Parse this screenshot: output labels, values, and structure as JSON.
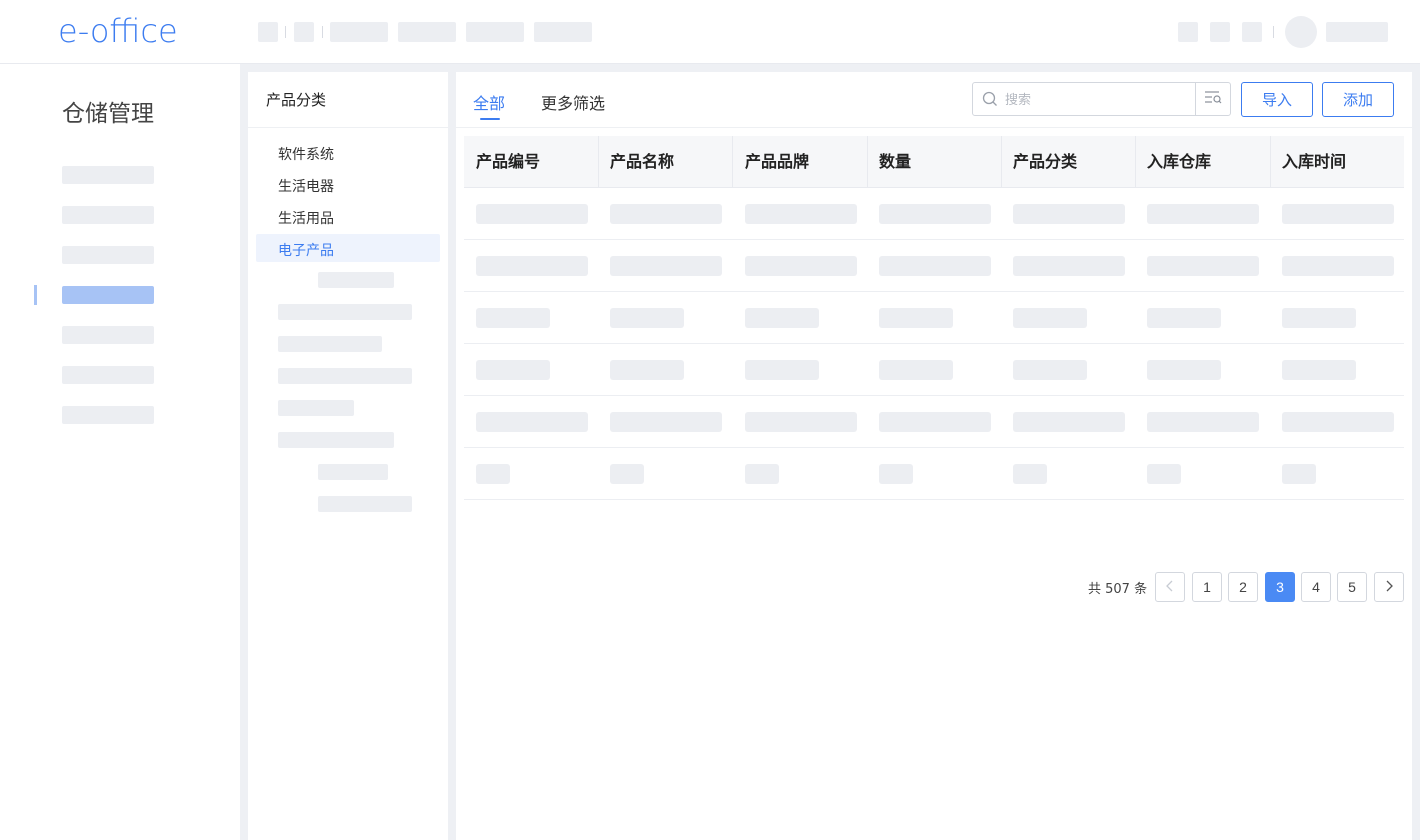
{
  "app": {
    "logo": "e-office"
  },
  "sidebar": {
    "title": "仓储管理"
  },
  "categories": {
    "header": "产品分类",
    "items": [
      {
        "label": "软件系统"
      },
      {
        "label": "生活电器"
      },
      {
        "label": "生活用品"
      },
      {
        "label": "电子产品",
        "active": true
      }
    ]
  },
  "main": {
    "tabs": [
      {
        "label": "全部",
        "active": true
      },
      {
        "label": "更多筛选"
      }
    ],
    "search": {
      "placeholder": "搜索",
      "value": ""
    },
    "buttons": {
      "import_label": "导入",
      "add_label": "添加"
    },
    "table": {
      "columns": [
        "产品编号",
        "产品名称",
        "产品品牌",
        "数量",
        "产品分类",
        "入库仓库",
        "入库时间"
      ]
    },
    "pagination": {
      "total_text": "共 507 条",
      "pages": [
        "1",
        "2",
        "3",
        "4",
        "5"
      ],
      "current": "3"
    }
  },
  "colors": {
    "accent": "#3c7cf0",
    "placeholder_bar": "#eceef2",
    "active_nav_bar": "#a7c3f5"
  },
  "icons": [
    "search-icon",
    "filter-icon",
    "chevron-left-icon",
    "chevron-right-icon"
  ]
}
